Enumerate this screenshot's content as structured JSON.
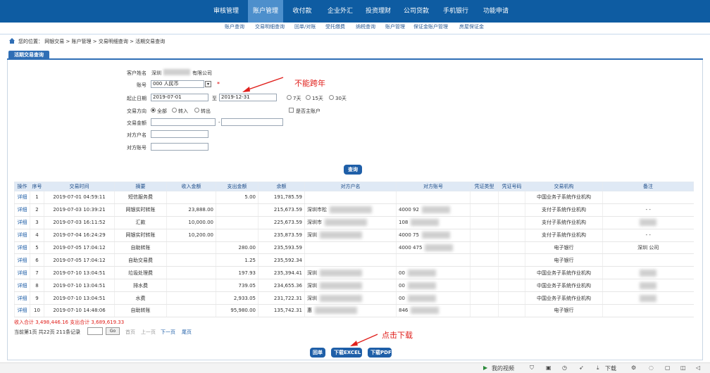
{
  "top_nav": [
    "审核管理",
    "账户管理",
    "收付款",
    "企业外汇",
    "投资理财",
    "公司贷款",
    "手机银行",
    "功能申请"
  ],
  "sub_nav": [
    "账户查询",
    "交易明细查询",
    "回单/对账",
    "受托缴费",
    "纳税查询",
    "账户管理",
    "保证金账户管理",
    "房屋保证金"
  ],
  "breadcrumb": "您的位置： 网银交易 > 账户管理 > 交易明细查询 > 活期交易查询",
  "tab_label": "活期交易查询",
  "form": {
    "customer_label": "客户姓名",
    "customer_value_prefix": "深圳",
    "customer_value_suffix": "有限公司",
    "account_label": "账号",
    "account_value": "000        人民币",
    "required_mark": "*",
    "date_label": "起止日期",
    "date_start": "2019-07-01",
    "date_to": "至",
    "date_end": "2019-12-31",
    "range_options": [
      "7天",
      "15天",
      "30天"
    ],
    "direction_label": "交易方向",
    "direction_options": [
      "全部",
      "转入",
      "转出"
    ],
    "direction_selected": "全部",
    "own_account_label": "是否主账户",
    "amount_label": "交易金额",
    "amount_sep": "-",
    "counterparty_name_label": "对方户名",
    "counterparty_acct_label": "对方账号",
    "query_button": "查询"
  },
  "annotations": {
    "no_cross_year": "不能跨年",
    "click_download": "点击下载"
  },
  "table": {
    "headers": [
      "操作",
      "序号",
      "交易时间",
      "摘要",
      "收入金额",
      "支出金额",
      "余额",
      "对方户名",
      "对方账号",
      "凭证类型",
      "凭证号码",
      "交易机构",
      "备注"
    ],
    "rows": [
      {
        "op": "详细",
        "no": "1",
        "time": "2019-07-01 04:59:11",
        "summary": "短信服务费",
        "income": "",
        "expense": "5.00",
        "balance": "191,785.59",
        "cp_name": "",
        "cp_acct": "",
        "org": "中国业务子系统作业机构",
        "remark": ""
      },
      {
        "op": "详细",
        "no": "2",
        "time": "2019-07-03 10:39:21",
        "summary": "网银实时转账",
        "income": "23,888.00",
        "expense": "",
        "balance": "215,673.59",
        "cp_name": "深圳市松",
        "cp_acct": "4000        92",
        "org": "支付子系统作业机构",
        "remark": "- -"
      },
      {
        "op": "详细",
        "no": "3",
        "time": "2019-07-03 16:11:52",
        "summary": "汇款",
        "income": "10,000.00",
        "expense": "",
        "balance": "225,673.59",
        "cp_name": "深圳市",
        "cp_acct": "108",
        "org": "支付子系统作业机构",
        "remark": ""
      },
      {
        "op": "详细",
        "no": "4",
        "time": "2019-07-04 16:24:29",
        "summary": "网银实时转账",
        "income": "10,200.00",
        "expense": "",
        "balance": "235,873.59",
        "cp_name": "深圳",
        "cp_acct": "4000        75",
        "org": "支付子系统作业机构",
        "remark": "- -"
      },
      {
        "op": "详细",
        "no": "5",
        "time": "2019-07-05 17:04:12",
        "summary": "自助转账",
        "income": "",
        "expense": "280.00",
        "balance": "235,593.59",
        "cp_name": "",
        "cp_acct": "4000        475",
        "org": "电子银行",
        "remark": "深圳        公司"
      },
      {
        "op": "详细",
        "no": "6",
        "time": "2019-07-05 17:04:12",
        "summary": "自助交易费",
        "income": "",
        "expense": "1.25",
        "balance": "235,592.34",
        "cp_name": "",
        "cp_acct": "",
        "org": "电子银行",
        "remark": ""
      },
      {
        "op": "详细",
        "no": "7",
        "time": "2019-07-10 13:04:51",
        "summary": "垃圾处理费",
        "income": "",
        "expense": "197.93",
        "balance": "235,394.41",
        "cp_name": "深圳",
        "cp_acct": "00",
        "org": "中国业务子系统作业机构",
        "remark": ""
      },
      {
        "op": "详细",
        "no": "8",
        "time": "2019-07-10 13:04:51",
        "summary": "排水费",
        "income": "",
        "expense": "739.05",
        "balance": "234,655.36",
        "cp_name": "深圳",
        "cp_acct": "00",
        "org": "中国业务子系统作业机构",
        "remark": ""
      },
      {
        "op": "详细",
        "no": "9",
        "time": "2019-07-10 13:04:51",
        "summary": "水费",
        "income": "",
        "expense": "2,933.05",
        "balance": "231,722.31",
        "cp_name": "深圳",
        "cp_acct": "00",
        "org": "中国业务子系统作业机构",
        "remark": ""
      },
      {
        "op": "详细",
        "no": "10",
        "time": "2019-07-10 14:48:06",
        "summary": "自助转账",
        "income": "",
        "expense": "95,980.00",
        "balance": "135,742.31",
        "cp_name": "惠",
        "cp_acct": "846",
        "org": "电子银行",
        "remark": ""
      }
    ]
  },
  "totals": "收入合计 3,498,446.16    支出合计 3,689,619.33",
  "pager": {
    "info": "当前第1页 共22页 211条记录",
    "go": "Go",
    "first": "首页",
    "prev": "上一页",
    "next": "下一页",
    "last": "尾页"
  },
  "bottom_buttons": [
    "回单",
    "下载EXCEL",
    "下载PDF"
  ],
  "status_bar": [
    "我的视频",
    "下载"
  ],
  "colors": {
    "nav": "#0e5ca2",
    "accent": "#1f5fa8",
    "annotation": "#e0201c"
  }
}
